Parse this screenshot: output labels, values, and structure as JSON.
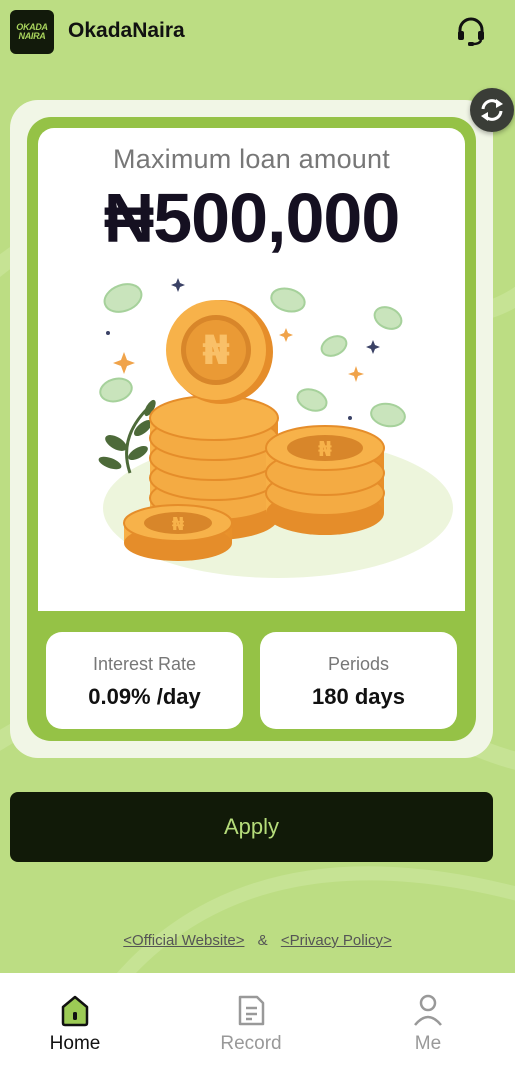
{
  "header": {
    "logo_line1": "OKADA",
    "logo_line2": "NAIRA",
    "app_name": "OkadaNaira",
    "support_icon": "headset-icon",
    "refresh_icon": "refresh-icon"
  },
  "loan": {
    "max_label": "Maximum loan amount",
    "max_amount": "₦500,000",
    "interest_label": "Interest Rate",
    "interest_value": "0.09% /day",
    "periods_label": "Periods",
    "periods_value": "180 days"
  },
  "apply_label": "Apply",
  "links": {
    "official": "<Official Website>",
    "separator": "&",
    "privacy": "<Privacy Policy>"
  },
  "nav": {
    "items": [
      {
        "label": "Home",
        "icon": "home-icon",
        "active": true
      },
      {
        "label": "Record",
        "icon": "document-icon",
        "active": false
      },
      {
        "label": "Me",
        "icon": "person-icon",
        "active": false
      }
    ]
  },
  "colors": {
    "background": "#bcdd83",
    "card_green": "#95c246",
    "apply_bg": "#111a08",
    "apply_text": "#b5dc7a",
    "coin": "#f2a93b"
  }
}
